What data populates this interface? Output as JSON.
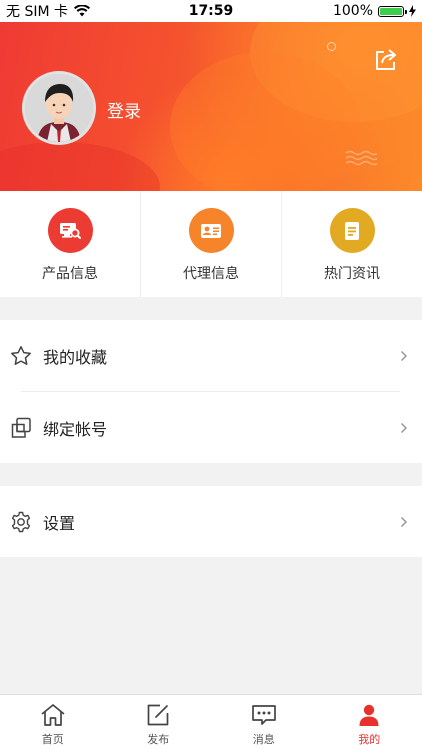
{
  "status_bar": {
    "carrier": "无 SIM 卡",
    "time": "17:59",
    "battery": "100%",
    "battery_level": 1.0
  },
  "header": {
    "login_label": "登录",
    "share_icon": "share-icon",
    "avatar_icon": "user-avatar"
  },
  "quick_links": [
    {
      "label": "产品信息",
      "icon": "product-search-icon",
      "color": "#ec3b32"
    },
    {
      "label": "代理信息",
      "icon": "id-card-icon",
      "color": "#f5842a"
    },
    {
      "label": "热门资讯",
      "icon": "document-icon",
      "color": "#e2aa22"
    }
  ],
  "menu_group_1": [
    {
      "label": "我的收藏",
      "icon": "star-icon"
    },
    {
      "label": "绑定帐号",
      "icon": "link-icon"
    }
  ],
  "menu_group_2": [
    {
      "label": "设置",
      "icon": "gear-icon"
    }
  ],
  "tabbar": {
    "tabs": [
      {
        "label": "首页",
        "icon": "home-icon"
      },
      {
        "label": "发布",
        "icon": "edit-icon"
      },
      {
        "label": "消息",
        "icon": "message-icon"
      },
      {
        "label": "我的",
        "icon": "person-icon"
      }
    ],
    "active_tab": "我的",
    "active_color": "#e8302d"
  }
}
